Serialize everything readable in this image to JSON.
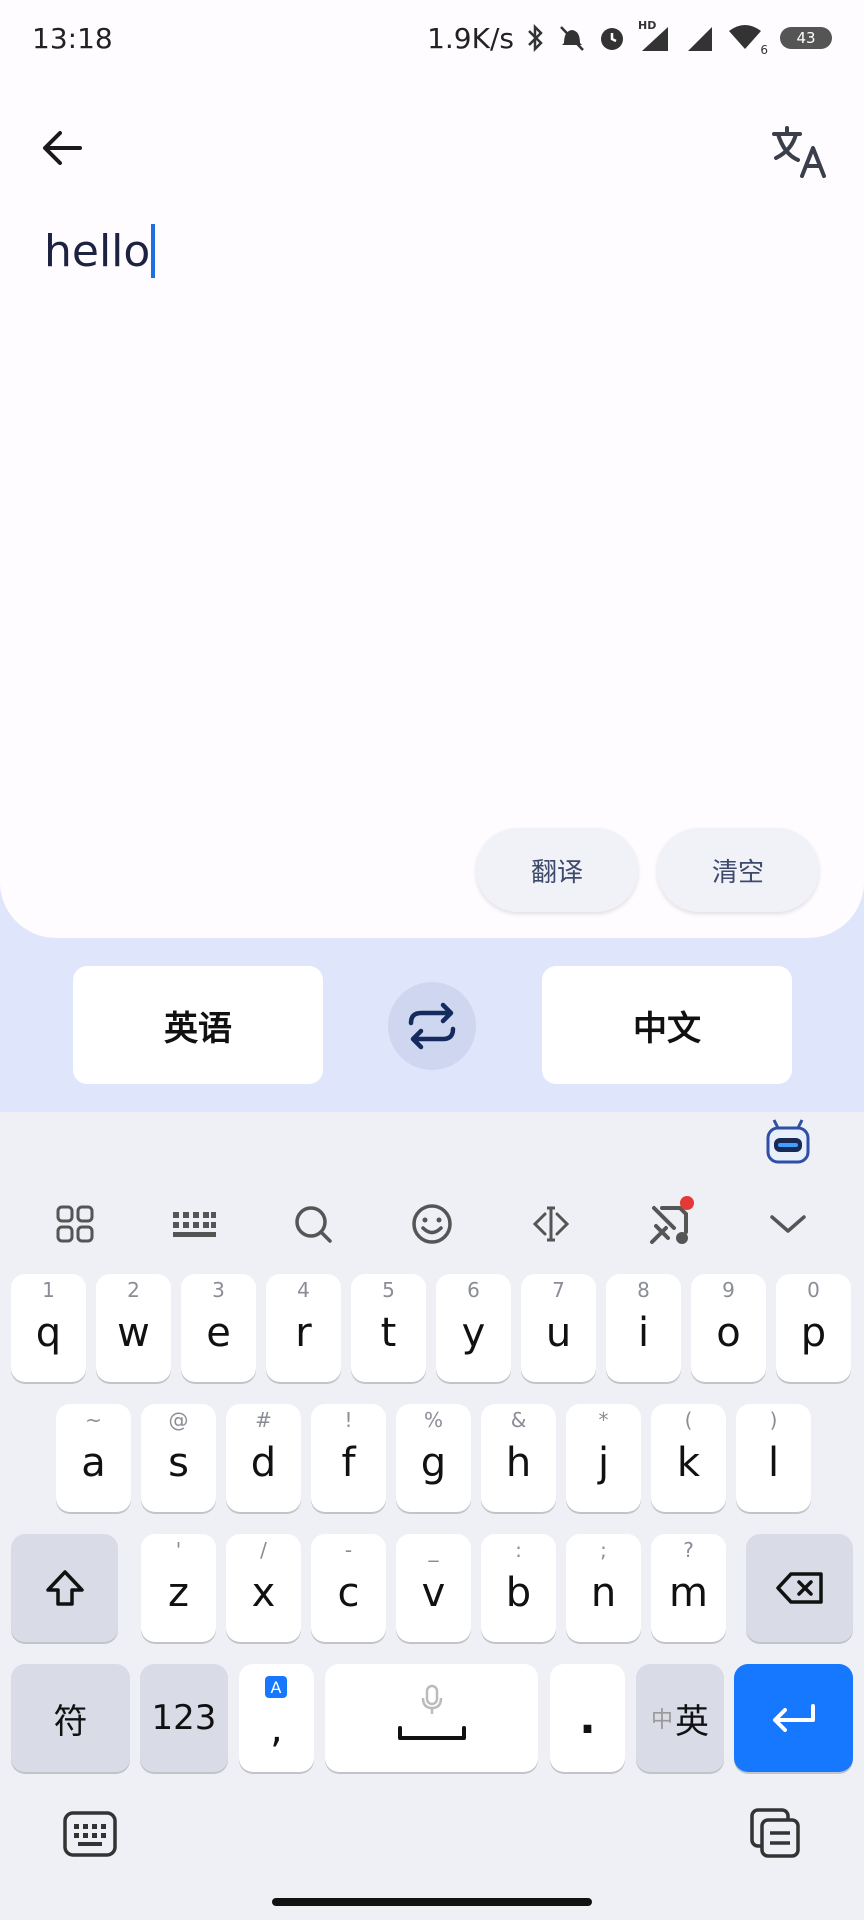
{
  "status": {
    "time": "13:18",
    "net_speed": "1.9K/s",
    "hd": "HD",
    "wifi_sub": "6",
    "battery": "43"
  },
  "panel": {
    "input_text": "hello",
    "translate_label": "翻译",
    "clear_label": "清空"
  },
  "lang": {
    "source": "英语",
    "target": "中文"
  },
  "keyboard": {
    "row1": [
      {
        "hint": "1",
        "key": "q"
      },
      {
        "hint": "2",
        "key": "w"
      },
      {
        "hint": "3",
        "key": "e"
      },
      {
        "hint": "4",
        "key": "r"
      },
      {
        "hint": "5",
        "key": "t"
      },
      {
        "hint": "6",
        "key": "y"
      },
      {
        "hint": "7",
        "key": "u"
      },
      {
        "hint": "8",
        "key": "i"
      },
      {
        "hint": "9",
        "key": "o"
      },
      {
        "hint": "0",
        "key": "p"
      }
    ],
    "row2": [
      {
        "hint": "~",
        "key": "a"
      },
      {
        "hint": "@",
        "key": "s"
      },
      {
        "hint": "#",
        "key": "d"
      },
      {
        "hint": "!",
        "key": "f"
      },
      {
        "hint": "%",
        "key": "g"
      },
      {
        "hint": "&",
        "key": "h"
      },
      {
        "hint": "*",
        "key": "j"
      },
      {
        "hint": "(",
        "key": "k"
      },
      {
        "hint": ")",
        "key": "l"
      }
    ],
    "row3": [
      {
        "hint": "'",
        "key": "z"
      },
      {
        "hint": "/",
        "key": "x"
      },
      {
        "hint": "-",
        "key": "c"
      },
      {
        "hint": "_",
        "key": "v"
      },
      {
        "hint": ":",
        "key": "b"
      },
      {
        "hint": ";",
        "key": "n"
      },
      {
        "hint": "?",
        "key": "m"
      }
    ],
    "symbol_label": "符",
    "num_label": "123",
    "comma_badge": "A",
    "comma_label": ",",
    "period_label": ".",
    "lang_small": "中",
    "lang_big": "英"
  },
  "icons": {
    "back": "arrow-left-icon",
    "translate": "translate-icon",
    "swap": "swap-icon",
    "enter": "enter-icon"
  },
  "colors": {
    "accent": "#1677ff",
    "panel_bg": "#fefcff",
    "lang_bar_bg": "#dfe6fb"
  }
}
